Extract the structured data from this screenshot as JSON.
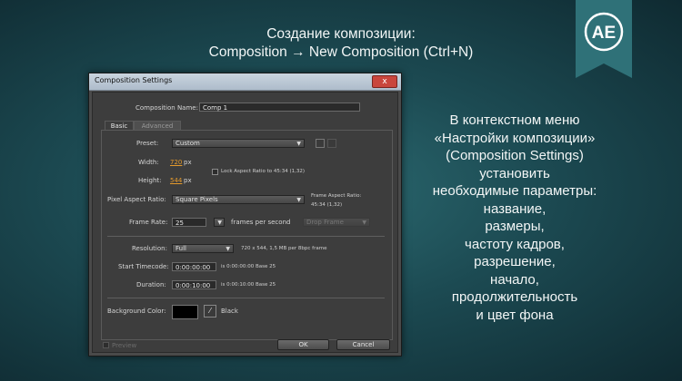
{
  "slide": {
    "title_line1": "Создание композиции:",
    "title_line2": "Composition → New Composition (Ctrl+N)",
    "badge": "AE",
    "side_text": [
      "В контекстном меню",
      "«Настройки композиции»",
      "(Composition Settings)",
      "установить",
      "необходимые параметры:",
      "название,",
      "размеры,",
      "частоту кадров,",
      "разрешение,",
      "начало,",
      "продолжительность",
      "и цвет фона"
    ]
  },
  "dialog": {
    "title": "Composition Settings",
    "close_label": "x",
    "comp_name_label": "Composition Name:",
    "comp_name_value": "Comp 1",
    "tabs": [
      "Basic",
      "Advanced"
    ],
    "preset_label": "Preset:",
    "preset_value": "Custom",
    "width_label": "Width:",
    "width_value": "720",
    "width_unit": "px",
    "height_label": "Height:",
    "height_value": "544",
    "height_unit": "px",
    "lock_aspect_label": "Lock Aspect Ratio to 45:34 (1,32)",
    "pixel_aspect_label": "Pixel Aspect Ratio:",
    "pixel_aspect_value": "Square Pixels",
    "frame_aspect_label": "Frame Aspect Ratio:",
    "frame_aspect_value": "45:34 (1,32)",
    "frame_rate_label": "Frame Rate:",
    "frame_rate_value": "25",
    "frame_rate_unit": "frames per second",
    "drop_frame_value": "Drop Frame",
    "resolution_label": "Resolution:",
    "resolution_value": "Full",
    "resolution_info": "720 x 544, 1,5 MB per 8bpc frame",
    "start_tc_label": "Start Timecode:",
    "start_tc_value": "0:00:00:00",
    "start_tc_info": "is 0:00:00:00  Base 25",
    "duration_label": "Duration:",
    "duration_value": "0:00:10:00",
    "duration_info": "is 0:00:10:00  Base 25",
    "bg_color_label": "Background Color:",
    "bg_color_name": "Black",
    "bg_color_hex": "#000000",
    "preview_label": "Preview",
    "ok_label": "OK",
    "cancel_label": "Cancel"
  }
}
